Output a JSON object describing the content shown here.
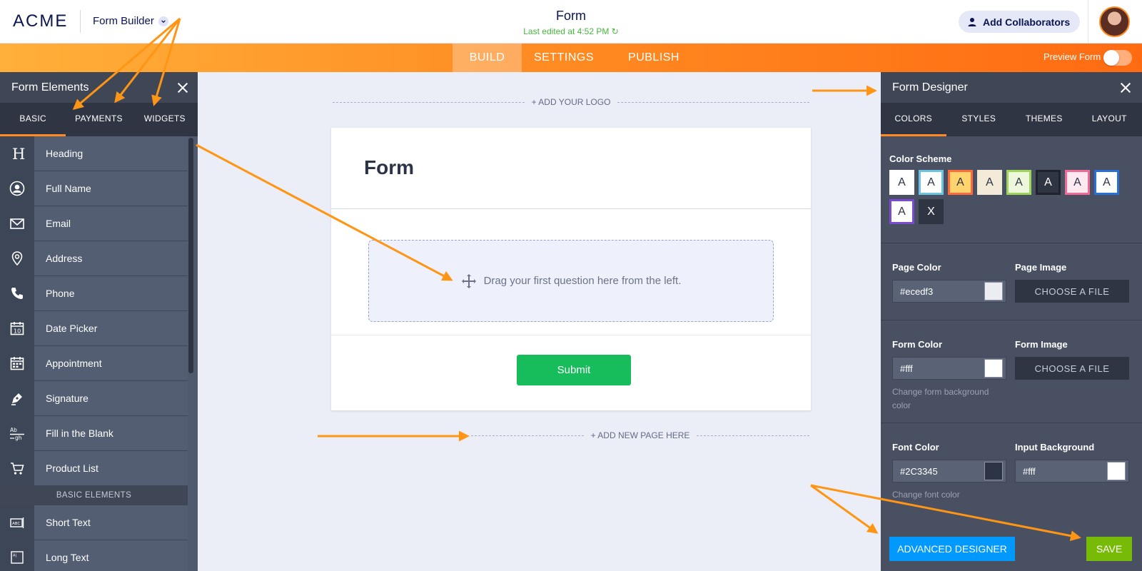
{
  "header": {
    "logo": "ACME",
    "builder_menu": "Form Builder",
    "title": "Form",
    "subtitle": "Last edited at 4:52 PM",
    "collaborators_button": "Add Collaborators"
  },
  "nav": {
    "tabs": [
      "BUILD",
      "SETTINGS",
      "PUBLISH"
    ],
    "active_tab": "BUILD",
    "preview_label": "Preview Form",
    "preview_enabled": false
  },
  "left_panel": {
    "title": "Form Elements",
    "tabs": [
      "BASIC",
      "PAYMENTS",
      "WIDGETS"
    ],
    "active_tab": "BASIC",
    "elements": [
      {
        "label": "Heading",
        "icon": "heading-icon"
      },
      {
        "label": "Full Name",
        "icon": "user-icon"
      },
      {
        "label": "Email",
        "icon": "envelope-icon"
      },
      {
        "label": "Address",
        "icon": "map-pin-icon"
      },
      {
        "label": "Phone",
        "icon": "phone-icon"
      },
      {
        "label": "Date Picker",
        "icon": "calendar-icon"
      },
      {
        "label": "Appointment",
        "icon": "appointment-icon"
      },
      {
        "label": "Signature",
        "icon": "pen-icon"
      },
      {
        "label": "Fill in the Blank",
        "icon": "fill-blank-icon"
      },
      {
        "label": "Product List",
        "icon": "cart-icon"
      }
    ],
    "section_label": "BASIC ELEMENTS",
    "basic_elements": [
      {
        "label": "Short Text",
        "icon": "short-text-icon"
      },
      {
        "label": "Long Text",
        "icon": "long-text-icon"
      }
    ]
  },
  "canvas": {
    "add_logo": "+ ADD YOUR LOGO",
    "form_title": "Form",
    "dropzone_text": "Drag your first question here from the left.",
    "submit_label": "Submit",
    "add_page": "+ ADD NEW PAGE HERE"
  },
  "right_panel": {
    "title": "Form Designer",
    "tabs": [
      "COLORS",
      "STYLES",
      "THEMES",
      "LAYOUT"
    ],
    "active_tab": "COLORS",
    "color_scheme_label": "Color Scheme",
    "swatches": [
      {
        "letter": "A",
        "bg": "#ffffff",
        "fg": "#2c3345",
        "border": "#ffffff"
      },
      {
        "letter": "A",
        "bg": "#ffffff",
        "fg": "#2c3345",
        "border": "#6cc4e0"
      },
      {
        "letter": "A",
        "bg": "#ffd36e",
        "fg": "#2c3345",
        "border": "#ff6a3d"
      },
      {
        "letter": "A",
        "bg": "#f3ead8",
        "fg": "#2c3345",
        "border": "#f3ead8"
      },
      {
        "letter": "A",
        "bg": "#eef7dc",
        "fg": "#2c3345",
        "border": "#9ed45a"
      },
      {
        "letter": "A",
        "bg": "#2f3542",
        "fg": "#ffffff",
        "border": "#1f232c"
      },
      {
        "letter": "A",
        "bg": "#fde9ef",
        "fg": "#2c3345",
        "border": "#f06a97"
      },
      {
        "letter": "A",
        "bg": "#ffffff",
        "fg": "#2c3345",
        "border": "#2a6fd6"
      },
      {
        "letter": "A",
        "bg": "#ffffff",
        "fg": "#2c3345",
        "border": "#7a4ad1"
      },
      {
        "letter": "X",
        "bg": "#2f3542",
        "fg": "#ffffff",
        "border": "#2f3542"
      }
    ],
    "page_color_label": "Page Color",
    "page_color_value": "#ecedf3",
    "page_color_chip": "#ecedf3",
    "page_image_label": "Page Image",
    "choose_file": "CHOOSE A FILE",
    "form_color_label": "Form Color",
    "form_color_value": "#fff",
    "form_color_chip": "#ffffff",
    "form_image_label": "Form Image",
    "form_color_hint": "Change form background color",
    "font_color_label": "Font Color",
    "font_color_value": "#2C3345",
    "font_color_chip": "#2c3345",
    "font_color_hint": "Change font color",
    "input_bg_label": "Input Background",
    "input_bg_value": "#fff",
    "input_bg_chip": "#ffffff",
    "advanced_button": "ADVANCED DESIGNER",
    "save_button": "SAVE"
  },
  "colors": {
    "accent_orange": "#ff8a22",
    "submit_green": "#18bd5b",
    "save_green": "#78bb07",
    "advanced_blue": "#0099ff"
  }
}
